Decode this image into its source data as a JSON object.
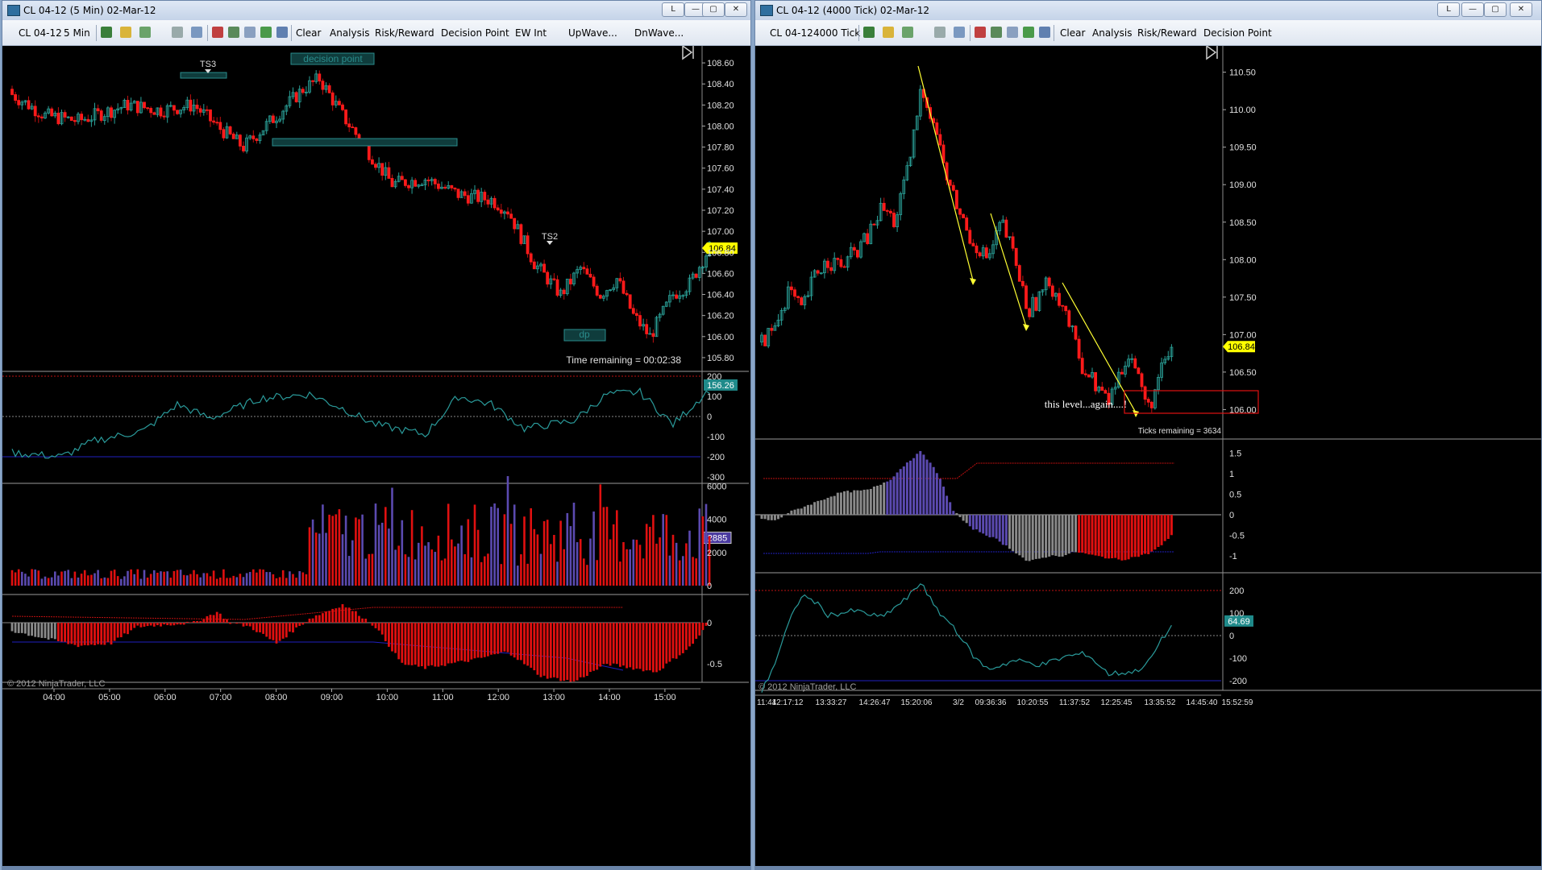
{
  "left": {
    "title": "CL 04-12 (5 Min)  02-Mar-12",
    "toolbar": {
      "instrument": "CL 04-12",
      "interval": "5 Min",
      "buttons": [
        "Clear",
        "Analysis",
        "Risk/Reward",
        "Decision Point",
        "EW Int",
        "UpWave...",
        "DnWave..."
      ]
    },
    "price_axis": [
      "108.60",
      "108.40",
      "108.20",
      "108.00",
      "107.80",
      "107.60",
      "107.40",
      "107.20",
      "107.00",
      "106.80",
      "106.60",
      "106.40",
      "106.20",
      "106.00",
      "105.80"
    ],
    "last_price": "106.84",
    "labels": {
      "ts3": "TS3",
      "ts2": "TS2",
      "decision_point": "decision point",
      "dp": "dp"
    },
    "time_remaining": "Time remaining = 00:02:38",
    "panel1_axis": [
      "200",
      "100",
      "0",
      "-100",
      "-200",
      "-300"
    ],
    "panel1_value": "156.26",
    "panel2_axis": [
      "6000",
      "4000",
      "2000",
      "0"
    ],
    "panel2_value": "2885",
    "panel3_axis": [
      "0",
      "-0.5"
    ],
    "copyright": "© 2012 NinjaTrader, LLC",
    "time_axis": [
      "04:00",
      "05:00",
      "06:00",
      "07:00",
      "08:00",
      "09:00",
      "10:00",
      "11:00",
      "12:00",
      "13:00",
      "14:00",
      "15:00"
    ]
  },
  "right": {
    "title": "CL 04-12 (4000 Tick)  02-Mar-12",
    "toolbar": {
      "instrument": "CL 04-12",
      "interval": "4000 Tick",
      "buttons": [
        "Clear",
        "Analysis",
        "Risk/Reward",
        "Decision Point"
      ]
    },
    "price_axis": [
      "110.50",
      "110.00",
      "109.50",
      "109.00",
      "108.50",
      "108.00",
      "107.50",
      "107.00",
      "106.50",
      "106.00"
    ],
    "last_price": "106.84",
    "annotation": "this level...again....!",
    "ticks_remaining": "Ticks remaining = 3634",
    "panel1_axis": [
      "1.5",
      "1",
      "0.5",
      "0",
      "-0.5",
      "-1"
    ],
    "panel2_axis": [
      "200",
      "100",
      "0",
      "-100",
      "-200"
    ],
    "panel2_value": "64.69",
    "copyright": "© 2012 NinjaTrader, LLC",
    "time_axis": [
      "11:44",
      "12:17:12",
      "13:33:27",
      "14:26:47",
      "15:20:06",
      "3/2",
      "09:36:36",
      "10:20:55",
      "11:37:52",
      "12:25:45",
      "13:35:52",
      "14:45:40",
      "15:52:59"
    ]
  },
  "colors": {
    "up": "#2aa198",
    "down": "#ff1a1a",
    "neutral": "#808080",
    "purple": "#5b4ab0",
    "last_price": "#ffff00"
  }
}
